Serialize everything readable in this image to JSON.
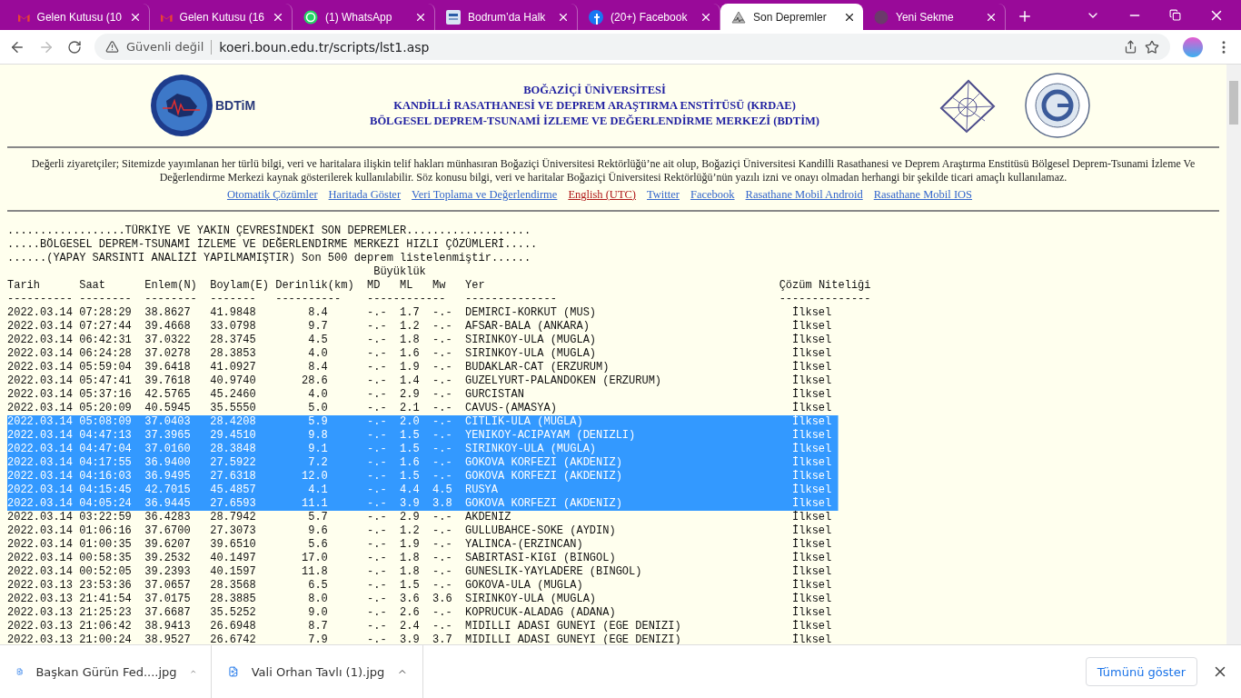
{
  "browser": {
    "tabs": [
      {
        "title": "Gelen Kutusu (10",
        "kind": "mail",
        "selected": false
      },
      {
        "title": "Gelen Kutusu (16",
        "kind": "mail",
        "selected": false
      },
      {
        "title": "(1) WhatsApp",
        "kind": "chat",
        "selected": false
      },
      {
        "title": "Bodrum’da Halk",
        "kind": "news",
        "selected": false
      },
      {
        "title": "(20+) Facebook",
        "kind": "social",
        "selected": false
      },
      {
        "title": "Son Depremler",
        "kind": "seismo",
        "selected": true
      },
      {
        "title": "Yeni Sekme",
        "kind": "blank",
        "selected": false
      }
    ],
    "address": {
      "security": "Güvenli değil",
      "url": "koeri.boun.edu.tr/scripts/lst1.asp"
    }
  },
  "page": {
    "header": {
      "logo_text": "BDTiM",
      "title_lines": [
        "BOĞAZİÇİ ÜNİVERSİTESİ",
        "KANDİLLİ RASATHANESİ VE DEPREM ARAŞTIRMA ENSTİTÜSÜ (KRDAE)",
        "BÖLGESEL DEPREM-TSUNAMİ İZLEME VE DEĞERLENDİRME MERKEZİ (BDTİM)"
      ]
    },
    "notice": "Değerli ziyaretçiler; Sitemizde yayımlanan her türlü bilgi, veri ve haritalara ilişkin telif hakları münhasıran Boğaziçi Üniversitesi Rektörlüğü’ne ait olup, Boğaziçi Üniversitesi Kandilli Rasathanesi ve Deprem Araştırma Enstitüsü Bölgesel Deprem-Tsunami İzleme Ve Değerlendirme Merkezi kaynak gösterilerek kullanılabilir. Söz konusu bilgi, veri ve haritalar Boğaziçi Üniversitesi Rektörlüğü’nün yazılı izni ve onayı olmadan herhangi bir şekilde ticari amaçlı kullanılamaz.",
    "links": [
      {
        "label": "Otomatik Çözümler",
        "color": "#3366cc"
      },
      {
        "label": "Haritada Göster",
        "color": "#3366cc"
      },
      {
        "label": "Veri Toplama ve Değerlendirme",
        "color": "#3366cc"
      },
      {
        "label": "English (UTC)",
        "color": "#b01818"
      },
      {
        "label": "Twitter",
        "color": "#3366cc"
      },
      {
        "label": "Facebook",
        "color": "#3366cc"
      },
      {
        "label": "Rasathane Mobil Android",
        "color": "#3366cc"
      },
      {
        "label": "Rasathane Mobil IOS",
        "color": "#3366cc"
      }
    ],
    "table": {
      "title_lines": [
        "..................TÜRKİYE VE YAKIN ÇEVRESİNDEKİ SON DEPREMLER...................",
        ".....BÖLGESEL DEPREM-TSUNAMİ İZLEME VE DEĞERLENDİRME MERKEZİ HIZLI ÇÖZÜMLERİ.....",
        "......(YAPAY SARSINTI ANALİZİ YAPILMAMIŞTIR) Son 500 deprem listelenmiştir......"
      ],
      "group_heading": {
        "label": "Büyüklük",
        "rule": "------------"
      },
      "columns": [
        {
          "label": "Tarih",
          "rule": "----------"
        },
        {
          "label": "Saat",
          "rule": "--------"
        },
        {
          "label": "Enlem(N)",
          "rule": "--------"
        },
        {
          "label": "Boylam(E)",
          "rule": "-------"
        },
        {
          "label": "Derinlik(km)",
          "rule": "----------"
        },
        {
          "label": "MD"
        },
        {
          "label": "ML"
        },
        {
          "label": "Mw"
        },
        {
          "label": "Yer",
          "rule": "--------------"
        },
        {
          "label": "Çözüm Niteliği",
          "rule": "--------------"
        }
      ],
      "rows": [
        {
          "date": "2022.03.14",
          "time": "07:28:29",
          "lat": "38.8627",
          "lon": "41.9848",
          "depth": "8.4",
          "md": "-.-",
          "ml": "1.7",
          "mw": "-.-",
          "place": "DEMIRCI-KORKUT (MUS)",
          "quality": "İlksel",
          "selected": false
        },
        {
          "date": "2022.03.14",
          "time": "07:27:44",
          "lat": "39.4668",
          "lon": "33.0798",
          "depth": "9.7",
          "md": "-.-",
          "ml": "1.2",
          "mw": "-.-",
          "place": "AFSAR-BALA (ANKARA)",
          "quality": "İlksel",
          "selected": false
        },
        {
          "date": "2022.03.14",
          "time": "06:42:31",
          "lat": "37.0322",
          "lon": "28.3745",
          "depth": "4.5",
          "md": "-.-",
          "ml": "1.8",
          "mw": "-.-",
          "place": "SIRINKOY-ULA (MUGLA)",
          "quality": "İlksel",
          "selected": false
        },
        {
          "date": "2022.03.14",
          "time": "06:24:28",
          "lat": "37.0278",
          "lon": "28.3853",
          "depth": "4.0",
          "md": "-.-",
          "ml": "1.6",
          "mw": "-.-",
          "place": "SIRINKOY-ULA (MUGLA)",
          "quality": "İlksel",
          "selected": false
        },
        {
          "date": "2022.03.14",
          "time": "05:59:04",
          "lat": "39.6418",
          "lon": "41.0927",
          "depth": "8.4",
          "md": "-.-",
          "ml": "1.9",
          "mw": "-.-",
          "place": "BUDAKLAR-CAT (ERZURUM)",
          "quality": "İlksel",
          "selected": false
        },
        {
          "date": "2022.03.14",
          "time": "05:47:41",
          "lat": "39.7618",
          "lon": "40.9740",
          "depth": "28.6",
          "md": "-.-",
          "ml": "1.4",
          "mw": "-.-",
          "place": "GUZELYURT-PALANDOKEN (ERZURUM)",
          "quality": "İlksel",
          "selected": false
        },
        {
          "date": "2022.03.14",
          "time": "05:37:16",
          "lat": "42.5765",
          "lon": "45.2460",
          "depth": "4.0",
          "md": "-.-",
          "ml": "2.9",
          "mw": "-.-",
          "place": "GURCISTAN",
          "quality": "İlksel",
          "selected": false
        },
        {
          "date": "2022.03.14",
          "time": "05:20:09",
          "lat": "40.5945",
          "lon": "35.5550",
          "depth": "5.0",
          "md": "-.-",
          "ml": "2.1",
          "mw": "-.-",
          "place": "CAVUS-(AMASYA)",
          "quality": "İlksel",
          "selected": false
        },
        {
          "date": "2022.03.14",
          "time": "05:08:09",
          "lat": "37.0403",
          "lon": "28.4208",
          "depth": "5.9",
          "md": "-.-",
          "ml": "2.0",
          "mw": "-.-",
          "place": "CITLIK-ULA (MUGLA)",
          "quality": "İlksel",
          "selected": true
        },
        {
          "date": "2022.03.14",
          "time": "04:47:13",
          "lat": "37.3965",
          "lon": "29.4510",
          "depth": "9.8",
          "md": "-.-",
          "ml": "1.5",
          "mw": "-.-",
          "place": "YENIKOY-ACIPAYAM (DENIZLI)",
          "quality": "İlksel",
          "selected": true
        },
        {
          "date": "2022.03.14",
          "time": "04:47:04",
          "lat": "37.0160",
          "lon": "28.3848",
          "depth": "9.1",
          "md": "-.-",
          "ml": "1.5",
          "mw": "-.-",
          "place": "SIRINKOY-ULA (MUGLA)",
          "quality": "İlksel",
          "selected": true
        },
        {
          "date": "2022.03.14",
          "time": "04:17:55",
          "lat": "36.9400",
          "lon": "27.5922",
          "depth": "7.2",
          "md": "-.-",
          "ml": "1.6",
          "mw": "-.-",
          "place": "GOKOVA KORFEZI (AKDENIZ)",
          "quality": "İlksel",
          "selected": true
        },
        {
          "date": "2022.03.14",
          "time": "04:16:03",
          "lat": "36.9495",
          "lon": "27.6318",
          "depth": "12.0",
          "md": "-.-",
          "ml": "1.5",
          "mw": "-.-",
          "place": "GOKOVA KORFEZI (AKDENIZ)",
          "quality": "İlksel",
          "selected": true
        },
        {
          "date": "2022.03.14",
          "time": "04:15:45",
          "lat": "42.7015",
          "lon": "45.4857",
          "depth": "4.1",
          "md": "-.-",
          "ml": "4.4",
          "mw": "4.5",
          "place": "RUSYA",
          "quality": "İlksel",
          "selected": true
        },
        {
          "date": "2022.03.14",
          "time": "04:05:24",
          "lat": "36.9445",
          "lon": "27.6593",
          "depth": "11.1",
          "md": "-.-",
          "ml": "3.9",
          "mw": "3.8",
          "place": "GOKOVA KORFEZI (AKDENIZ)",
          "quality": "İlksel",
          "selected": true
        },
        {
          "date": "2022.03.14",
          "time": "03:22:59",
          "lat": "36.4283",
          "lon": "28.7942",
          "depth": "5.7",
          "md": "-.-",
          "ml": "2.9",
          "mw": "-.-",
          "place": "AKDENIZ",
          "quality": "İlksel",
          "selected": false
        },
        {
          "date": "2022.03.14",
          "time": "01:06:16",
          "lat": "37.6700",
          "lon": "27.3073",
          "depth": "9.6",
          "md": "-.-",
          "ml": "1.2",
          "mw": "-.-",
          "place": "GULLUBAHCE-SOKE (AYDIN)",
          "quality": "İlksel",
          "selected": false
        },
        {
          "date": "2022.03.14",
          "time": "01:00:35",
          "lat": "39.6207",
          "lon": "39.6510",
          "depth": "5.6",
          "md": "-.-",
          "ml": "1.9",
          "mw": "-.-",
          "place": "YALINCA-(ERZINCAN)",
          "quality": "İlksel",
          "selected": false
        },
        {
          "date": "2022.03.14",
          "time": "00:58:35",
          "lat": "39.2532",
          "lon": "40.1497",
          "depth": "17.0",
          "md": "-.-",
          "ml": "1.8",
          "mw": "-.-",
          "place": "SABIRTASI-KIGI (BINGOL)",
          "quality": "İlksel",
          "selected": false
        },
        {
          "date": "2022.03.14",
          "time": "00:52:05",
          "lat": "39.2393",
          "lon": "40.1597",
          "depth": "11.8",
          "md": "-.-",
          "ml": "1.8",
          "mw": "-.-",
          "place": "GUNESLIK-YAYLADERE (BINGOL)",
          "quality": "İlksel",
          "selected": false
        },
        {
          "date": "2022.03.13",
          "time": "23:53:36",
          "lat": "37.0657",
          "lon": "28.3568",
          "depth": "6.5",
          "md": "-.-",
          "ml": "1.5",
          "mw": "-.-",
          "place": "GOKOVA-ULA (MUGLA)",
          "quality": "İlksel",
          "selected": false
        },
        {
          "date": "2022.03.13",
          "time": "21:41:54",
          "lat": "37.0175",
          "lon": "28.3885",
          "depth": "8.0",
          "md": "-.-",
          "ml": "3.6",
          "mw": "3.6",
          "place": "SIRINKOY-ULA (MUGLA)",
          "quality": "İlksel",
          "selected": false
        },
        {
          "date": "2022.03.13",
          "time": "21:25:23",
          "lat": "37.6687",
          "lon": "35.5252",
          "depth": "9.0",
          "md": "-.-",
          "ml": "2.6",
          "mw": "-.-",
          "place": "KOPRUCUK-ALADAG (ADANA)",
          "quality": "İlksel",
          "selected": false
        },
        {
          "date": "2022.03.13",
          "time": "21:06:42",
          "lat": "38.9413",
          "lon": "26.6948",
          "depth": "8.7",
          "md": "-.-",
          "ml": "2.4",
          "mw": "-.-",
          "place": "MIDILLI ADASI GUNEYI (EGE DENIZI)",
          "quality": "İlksel",
          "selected": false
        },
        {
          "date": "2022.03.13",
          "time": "21:00:24",
          "lat": "38.9527",
          "lon": "26.6742",
          "depth": "7.9",
          "md": "-.-",
          "ml": "3.9",
          "mw": "3.7",
          "place": "MIDILLI ADASI GUNEYI (EGE DENIZI)",
          "quality": "İlksel",
          "selected": false
        }
      ]
    }
  },
  "downloads": {
    "items": [
      {
        "name": "Başkan Gürün Fed....jpg"
      },
      {
        "name": "Vali Orhan Tavlı (1).jpg"
      }
    ],
    "show_all": "Tümünü göster"
  }
}
